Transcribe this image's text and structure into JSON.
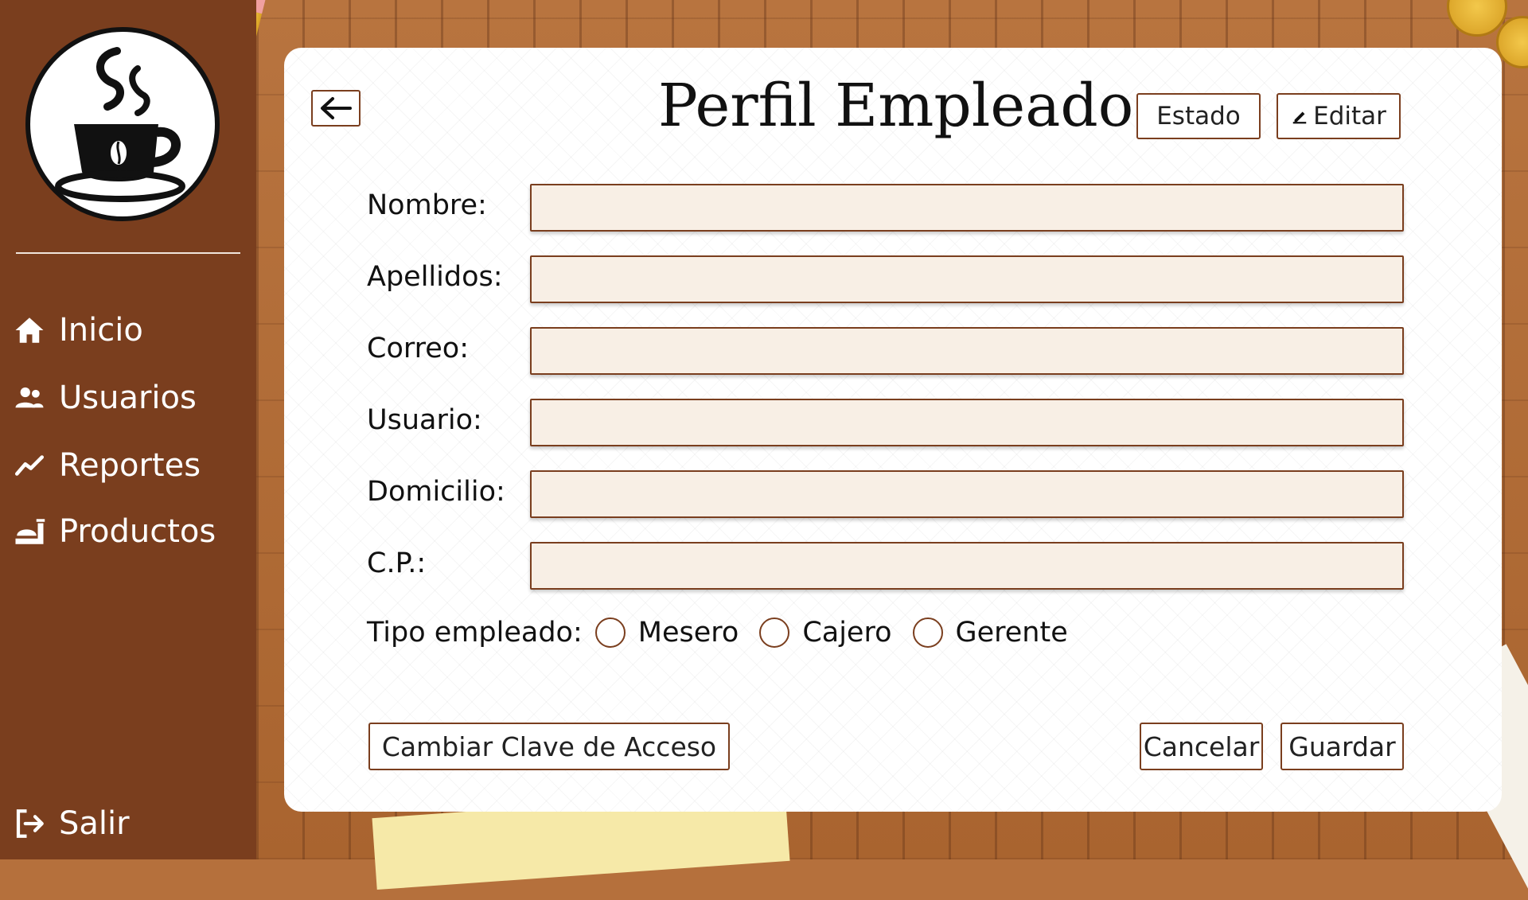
{
  "sidebar": {
    "items": [
      {
        "label": "Inicio",
        "icon": "home-icon"
      },
      {
        "label": "Usuarios",
        "icon": "users-icon"
      },
      {
        "label": "Reportes",
        "icon": "trend-icon"
      },
      {
        "label": "Productos",
        "icon": "products-icon"
      }
    ],
    "logout_label": "Salir"
  },
  "header": {
    "title": "Perfil Empleado",
    "estado_label": "Estado",
    "editar_label": "Editar"
  },
  "form": {
    "fields": [
      {
        "label": "Nombre:",
        "value": ""
      },
      {
        "label": "Apellidos:",
        "value": ""
      },
      {
        "label": "Correo:",
        "value": ""
      },
      {
        "label": "Usuario:",
        "value": ""
      },
      {
        "label": "Domicilio:",
        "value": ""
      },
      {
        "label": "C.P.:",
        "value": ""
      }
    ],
    "tipo_label": "Tipo empleado:",
    "tipo_options": [
      "Mesero",
      "Cajero",
      "Gerente"
    ]
  },
  "actions": {
    "change_password": "Cambiar Clave de Acceso",
    "cancel": "Cancelar",
    "save": "Guardar"
  },
  "colors": {
    "sidebar": "#7a3e1e",
    "accent_border": "#7a3e1e",
    "input_bg": "#f8efe5",
    "desk": "#b5703c"
  }
}
